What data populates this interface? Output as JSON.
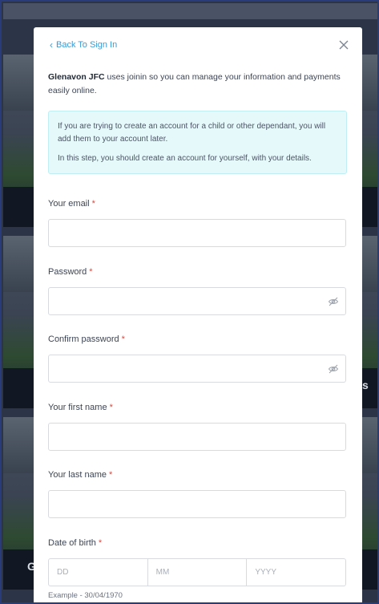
{
  "modal": {
    "back_link": "Back To Sign In",
    "intro_org": "Glenavon JFC",
    "intro_text": " uses joinin so you can manage your information and payments easily online.",
    "notice_line1": "If you are trying to create an account for a child or other dependant, you will add them to your account later.",
    "notice_line2": "In this step, you should create an account for yourself, with your details."
  },
  "form": {
    "email_label": "Your email",
    "password_label": "Password",
    "confirm_password_label": "Confirm password",
    "first_name_label": "Your first name",
    "last_name_label": "Your last name",
    "dob_label": "Date of birth",
    "required_mark": "*",
    "dob_day_placeholder": "DD",
    "dob_month_placeholder": "MM",
    "dob_year_placeholder": "YYYY",
    "dob_hint": "Example - 30/04/1970"
  },
  "background": {
    "letter_left": "G",
    "letter_right": "s"
  },
  "colors": {
    "link": "#3b9bd6",
    "required": "#e0463c",
    "notice_bg": "#e6f9fa"
  }
}
